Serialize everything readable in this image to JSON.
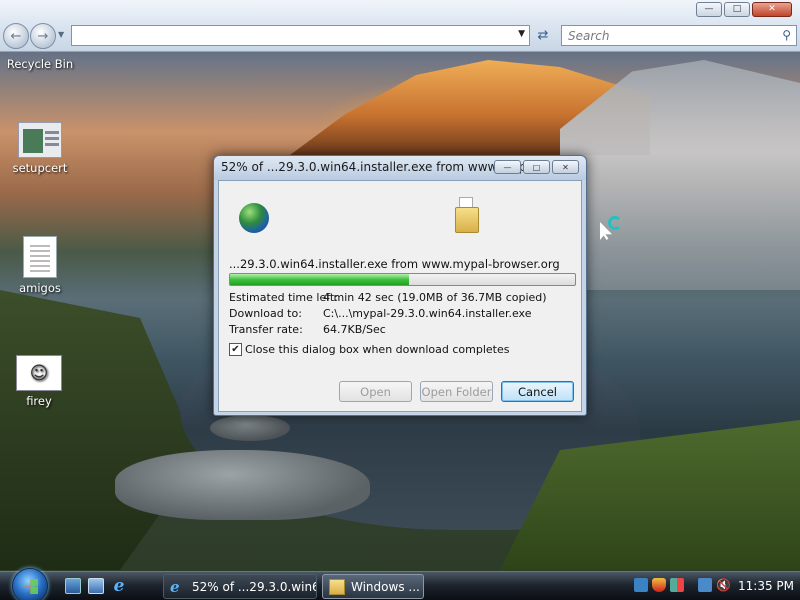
{
  "browser": {
    "address_value": "",
    "search_placeholder": "Search",
    "window_controls": [
      "minimize",
      "maximize",
      "close"
    ]
  },
  "desktop": {
    "icons": [
      {
        "label": "Recycle Bin",
        "icon": "recycle-bin-icon"
      },
      {
        "label": "setupcert",
        "icon": "setupcert-app-icon"
      },
      {
        "label": "amigos",
        "icon": "document-icon"
      },
      {
        "label": "firey",
        "icon": "image-file-icon"
      }
    ]
  },
  "dialog": {
    "title": "52% of ...29.3.0.win64.installer.exe from www.myp...",
    "source_line": "...29.3.0.win64.installer.exe from www.mypal-browser.org",
    "progress_percent": 52,
    "rows": [
      {
        "label": "Estimated time left:",
        "value": "4 min 42 sec (19.0MB of 36.7MB copied)"
      },
      {
        "label": "Download to:",
        "value": "C:\\...\\mypal-29.3.0.win64.installer.exe"
      },
      {
        "label": "Transfer rate:",
        "value": "64.7KB/Sec"
      }
    ],
    "close_when_done": {
      "label": "Close this dialog box when download completes",
      "checked": true
    },
    "buttons": {
      "open": "Open",
      "open_folder": "Open Folder",
      "cancel": "Cancel"
    }
  },
  "taskbar": {
    "tasks": [
      {
        "label": "52% of ...29.3.0.win6...",
        "icon": "ie-icon",
        "active": false
      },
      {
        "label": "Windows ...",
        "icon": "folder-icon",
        "active": true
      }
    ],
    "clock": "11:35 PM"
  },
  "colors": {
    "progress_fill": "#3ec13e",
    "dialog_frame": "#c4d4e6",
    "taskbar": "#1e252e"
  }
}
